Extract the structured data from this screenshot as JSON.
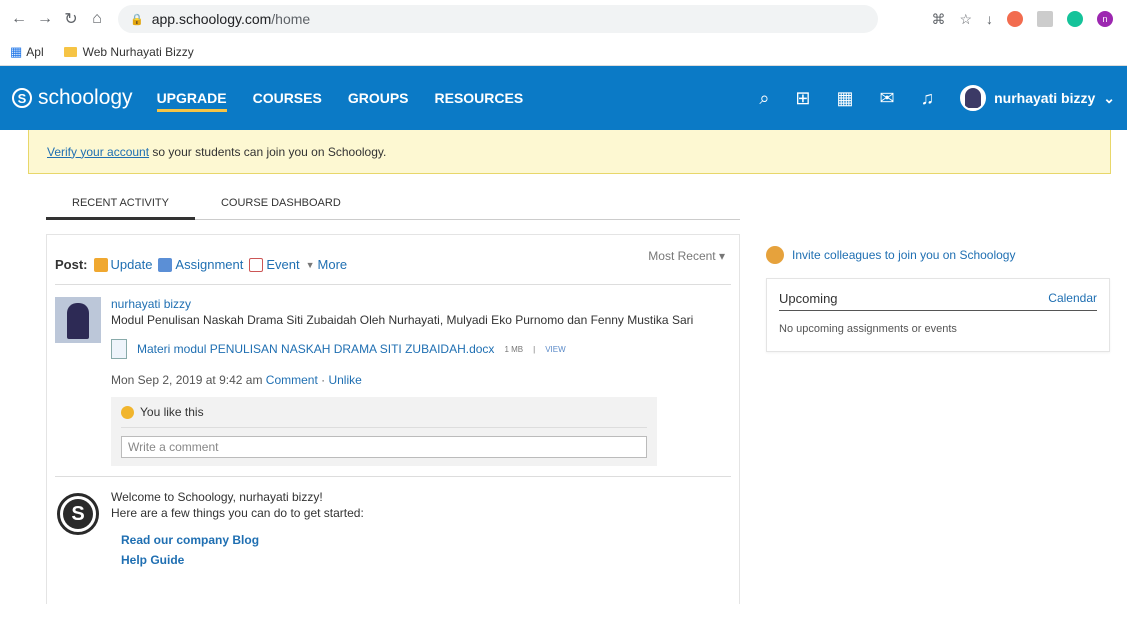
{
  "browser": {
    "url_host": "app.schoology.com",
    "url_path": "/home",
    "bookmarks": [
      {
        "label": "Apl"
      },
      {
        "label": "Web Nurhayati Bizzy"
      }
    ],
    "profile_initial": "n"
  },
  "header": {
    "logo": "schoology",
    "nav": [
      {
        "label": "UPGRADE",
        "active": true
      },
      {
        "label": "COURSES"
      },
      {
        "label": "GROUPS"
      },
      {
        "label": "RESOURCES"
      }
    ],
    "username": "nurhayati bizzy",
    "accent": "#0b7ac6"
  },
  "banner": {
    "link": "Verify your account",
    "text": " so your students can join you on Schoology."
  },
  "tabs": [
    {
      "label": "RECENT ACTIVITY",
      "active": true
    },
    {
      "label": "COURSE DASHBOARD"
    }
  ],
  "post_bar": {
    "label": "Post:",
    "update": "Update",
    "assignment": "Assignment",
    "event": "Event",
    "more": "More",
    "sort": "Most Recent"
  },
  "post": {
    "author": "nurhayati bizzy",
    "text": "Modul Penulisan Naskah Drama Siti Zubaidah Oleh Nurhayati, Mulyadi Eko Purnomo dan Fenny Mustika Sari",
    "file_name": "Materi modul PENULISAN NASKAH DRAMA SITI ZUBAIDAH.docx",
    "file_size": "1 MB",
    "file_view": "VIEW",
    "timestamp": "Mon Sep 2, 2019 at 9:42 am",
    "comment_link": "Comment",
    "unlike_link": "Unlike",
    "likes_text": "You like this",
    "comment_placeholder": "Write a comment"
  },
  "welcome": {
    "title": "Welcome to Schoology, nurhayati bizzy!",
    "subtitle": "Here are a few things you can do to get started:",
    "links": [
      "Read our company Blog",
      "Help Guide"
    ]
  },
  "sidebar": {
    "invite": "Invite colleagues to join you on Schoology",
    "upcoming_title": "Upcoming",
    "calendar_link": "Calendar",
    "empty": "No upcoming assignments or events"
  }
}
